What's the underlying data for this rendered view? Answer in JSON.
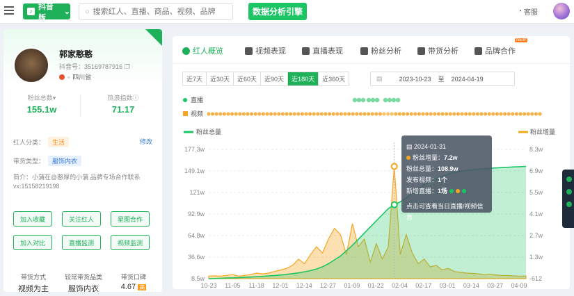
{
  "topbar": {
    "brand_label": "抖音版",
    "search_placeholder": "搜索红人、直播、商品、视频、品牌",
    "promo_label": "数据分析引擎",
    "service_label": "客服"
  },
  "profile": {
    "name": "郭家憨憨",
    "douyin_id": "抖音号：35169787916",
    "location": "四川省",
    "fans_label": "粉丝总数",
    "fans_value": "155.1w",
    "heat_label": "热浪指数",
    "heat_value": "71.17",
    "category_label": "红人分类：",
    "category_tag": "生活",
    "edit_label": "修改",
    "goods_label": "带货类型：",
    "goods_tag": "服饰内衣",
    "intro": "简介：小蒲在@憨厚的小蒲 品牌专场合作联系vx:15158219198",
    "buttons": [
      "加入收藏",
      "关注红人",
      "星图合作",
      "加入对比",
      "直播监测",
      "视频监测"
    ],
    "bottom": [
      {
        "label": "带货方式",
        "value": "视频为主"
      },
      {
        "label": "较常带货品类",
        "value": "服饰内衣"
      },
      {
        "label": "带货口碑",
        "value": "4.67"
      }
    ]
  },
  "tabs": [
    "红人概览",
    "视频表现",
    "直播表现",
    "粉丝分析",
    "带货分析",
    "品牌合作"
  ],
  "new_badge": "NEW",
  "ranges": [
    "近7天",
    "近30天",
    "近60天",
    "近90天",
    "近180天",
    "近360天"
  ],
  "active_range": "近180天",
  "date_start": "2023-10-23",
  "date_to": "至",
  "date_end": "2024-04-19",
  "tooltip": {
    "date": "2024-01-31",
    "fans_inc_label": "粉丝增量：",
    "fans_inc": "7.2w",
    "fans_total_label": "粉丝总量：",
    "fans_total": "108.9w",
    "video_label": "发布视频：",
    "video": "1个",
    "live_label": "新增直播：",
    "live": "1场",
    "hint": "点击可查看当日直播/视频信息"
  },
  "chart_data": {
    "type": "line",
    "legend_live": "直播",
    "legend_video": "视频",
    "series": [
      {
        "name": "粉丝总量",
        "color": "#1bc564"
      },
      {
        "name": "粉丝增量",
        "color": "#f5a623"
      }
    ],
    "y_left": [
      "177.3w",
      "149.1w",
      "121w",
      "92.9w",
      "64.8w",
      "36.6w",
      "8.5w"
    ],
    "y_right": [
      "8.3w",
      "6.9w",
      "5.5w",
      "4.1w",
      "2.7w",
      "1.3w",
      "-612"
    ],
    "x": [
      "10-23",
      "11-05",
      "11-18",
      "12-01",
      "12-14",
      "12-27",
      "01-09",
      "01-22",
      "02-04",
      "02-17",
      "03-01",
      "03-14",
      "03-27",
      "04-09"
    ],
    "fans_total": [
      8.5,
      8.7,
      9.0,
      9.3,
      9.5,
      9.8,
      10.2,
      10.6,
      11,
      11.5,
      12,
      12.6,
      13.2,
      14,
      15,
      16,
      17.5,
      19,
      21,
      24,
      28,
      33,
      38,
      45,
      52,
      60,
      68,
      76,
      84,
      92,
      100,
      105,
      108.9,
      114,
      120,
      126,
      131,
      135,
      139,
      142,
      145,
      147,
      148.5,
      149.5,
      150.5,
      151.3,
      152,
      152.6,
      153.1,
      153.6,
      154,
      154.4,
      154.7,
      155.1
    ],
    "fans_inc": [
      0.1,
      0.12,
      0.1,
      0.15,
      0.2,
      0.1,
      0.15,
      0.2,
      0.3,
      0.25,
      0.3,
      0.4,
      0.5,
      0.6,
      0.8,
      1.2,
      0.9,
      1.5,
      2.0,
      1.6,
      2.5,
      3.2,
      2.8,
      1.5,
      3.5,
      2.0,
      2.5,
      1.0,
      2.2,
      1.2,
      2.0,
      7.2,
      1.5,
      2.8,
      1.6,
      0.9,
      1.2,
      0.7,
      0.8,
      0.5,
      0.6,
      0.4,
      0.35,
      0.3,
      0.28,
      0.25,
      0.2,
      0.22,
      0.18,
      0.15,
      0.14,
      0.12,
      0.1,
      0.1
    ]
  }
}
